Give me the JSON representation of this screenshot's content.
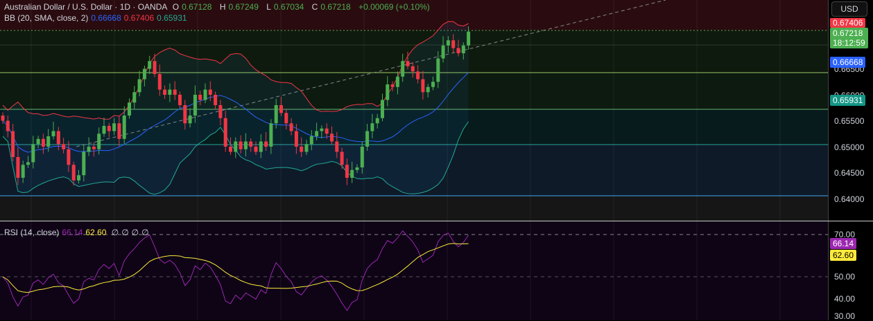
{
  "header": {
    "symbol": "Australian Dollar / U.S. Dollar · 1D · OANDA",
    "o_label": "O",
    "o": "0.67128",
    "h_label": "H",
    "h": "0.67249",
    "l_label": "L",
    "l": "0.67034",
    "c_label": "C",
    "c": "0.67218",
    "change": "+0.00069 (+0.10%)"
  },
  "bb": {
    "label": "BB (20, SMA, close, 2)",
    "basis": "0.66668",
    "upper": "0.67406",
    "lower": "0.65931"
  },
  "rsi": {
    "label": "RSI (14, close)",
    "value": "66.14",
    "ma": "62.60",
    "extra": [
      "∅",
      "∅",
      "∅",
      "∅"
    ]
  },
  "axis": {
    "currency": "USD",
    "ticks": [
      "0.66500",
      "0.66000",
      "0.65500",
      "0.65000",
      "0.64500",
      "0.64000"
    ],
    "rsi_ticks": [
      "70.00",
      "50.00",
      "40.00",
      "30.00"
    ],
    "tags": {
      "upper": "0.67406",
      "price": "0.67218",
      "countdown": "18:12:59",
      "basis": "0.66668",
      "lower": "0.65931",
      "rsi": "66.14",
      "rsi_ma": "62.60"
    }
  },
  "colors": {
    "up": "#4caf50",
    "down": "#f23645",
    "basis": "#2962ff",
    "upper": "#f23645",
    "lower": "#22ab94",
    "rsi": "#9c27b0",
    "rsi_ma": "#ffeb3b"
  },
  "chart_data": {
    "type": "candlestick",
    "ylim": [
      0.6385,
      0.6775
    ],
    "closes": [
      0.655,
      0.653,
      0.648,
      0.644,
      0.6465,
      0.647,
      0.6505,
      0.6515,
      0.65,
      0.652,
      0.653,
      0.6505,
      0.6495,
      0.6465,
      0.6435,
      0.6445,
      0.649,
      0.65,
      0.6495,
      0.6525,
      0.654,
      0.653,
      0.6545,
      0.6515,
      0.656,
      0.6585,
      0.6605,
      0.663,
      0.665,
      0.6665,
      0.664,
      0.661,
      0.66,
      0.661,
      0.66,
      0.658,
      0.6545,
      0.656,
      0.66,
      0.659,
      0.661,
      0.66,
      0.658,
      0.6555,
      0.65,
      0.649,
      0.651,
      0.6495,
      0.651,
      0.65,
      0.649,
      0.651,
      0.65,
      0.6545,
      0.658,
      0.6565,
      0.6545,
      0.653,
      0.65,
      0.649,
      0.6505,
      0.652,
      0.653,
      0.6535,
      0.6525,
      0.651,
      0.649,
      0.6465,
      0.644,
      0.6455,
      0.646,
      0.65,
      0.653,
      0.6545,
      0.6555,
      0.659,
      0.662,
      0.6615,
      0.6635,
      0.6665,
      0.6655,
      0.6645,
      0.663,
      0.6605,
      0.6615,
      0.6625,
      0.667,
      0.6695,
      0.6705,
      0.669,
      0.668,
      0.6695,
      0.67218
    ]
  }
}
